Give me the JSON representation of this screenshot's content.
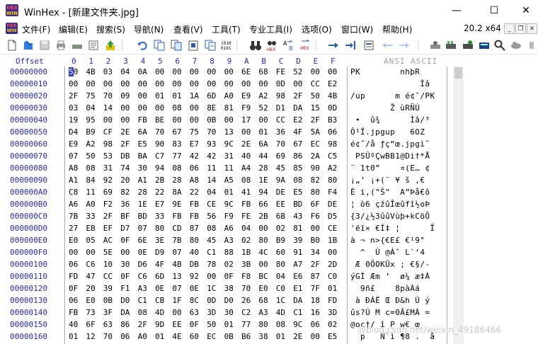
{
  "window": {
    "title": "WinHex - [新建文件夹.jpg]",
    "app_icon": "winhex-icon",
    "minimize": "—",
    "maximize": "☐",
    "close": "✕"
  },
  "menu": {
    "items": [
      "文件(F)",
      "编辑(E)",
      "搜索(S)",
      "导航(N)",
      "查看(V)",
      "工具(T)",
      "专业工具(I)",
      "选项(O)",
      "窗口(W)",
      "帮助(H)"
    ],
    "version": "20.2 x64",
    "mdi_minimize": "_",
    "mdi_restore": "❐",
    "mdi_close": "✕"
  },
  "toolbar": {
    "icons": [
      "new-file-icon",
      "open-file-icon",
      "save-icon",
      "print-icon",
      "disk-icon",
      "properties-icon",
      "up-arrow-icon",
      "undo-icon",
      "copy-icon",
      "paste-block-icon",
      "paste-icon",
      "insert-icon",
      "convert-icon",
      "binoculars-icon",
      "find-hex-icon",
      "replace-text-icon",
      "replace-hex-icon",
      "goto-icon",
      "goto-offset-icon",
      "back-icon",
      "forward-icon",
      "disk-editor-icon",
      "ram-editor-icon",
      "calculator-icon",
      "search-toolbar-icon",
      "cloud-icon"
    ]
  },
  "editor": {
    "offset_header": "Offset",
    "column_headers": [
      "0",
      "1",
      "2",
      "3",
      "4",
      "5",
      "6",
      "7",
      "8",
      "9",
      "A",
      "B",
      "C",
      "D",
      "E",
      "F"
    ],
    "ansi_header": "ANSI ASCII",
    "rows": [
      {
        "offset": "00000000",
        "bytes": [
          "50",
          "4B",
          "03",
          "04",
          "0A",
          "00",
          "00",
          "00",
          "00",
          "00",
          "6E",
          "68",
          "FE",
          "52",
          "00",
          "00"
        ],
        "ansi": "PK        nhþR  "
      },
      {
        "offset": "00000010",
        "bytes": [
          "00",
          "00",
          "00",
          "00",
          "00",
          "00",
          "00",
          "00",
          "00",
          "00",
          "00",
          "00",
          "0D",
          "00",
          "CC",
          "E2"
        ],
        "ansi": "              Ìâ"
      },
      {
        "offset": "00000020",
        "bytes": [
          "2F",
          "75",
          "70",
          "09",
          "00",
          "01",
          "01",
          "1A",
          "6D",
          "A0",
          "E9",
          "A2",
          "98",
          "2F",
          "50",
          "4B"
        ],
        "ansi": "/up      m é¢˜/PK"
      },
      {
        "offset": "00000030",
        "bytes": [
          "03",
          "04",
          "14",
          "00",
          "00",
          "00",
          "08",
          "00",
          "8E",
          "81",
          "F9",
          "52",
          "D1",
          "DA",
          "15",
          "0D"
        ],
        "ansi": "        Ž ùRÑÚ  "
      },
      {
        "offset": "00000040",
        "bytes": [
          "19",
          "95",
          "00",
          "00",
          "FB",
          "BE",
          "00",
          "00",
          "0B",
          "00",
          "17",
          "00",
          "CC",
          "E2",
          "2F",
          "B3"
        ],
        "ansi": " •  û¾      Ìâ/³"
      },
      {
        "offset": "00000050",
        "bytes": [
          "D4",
          "B9",
          "CF",
          "2E",
          "6A",
          "70",
          "67",
          "75",
          "70",
          "13",
          "00",
          "01",
          "36",
          "4F",
          "5A",
          "06"
        ],
        "ansi": "Ô¹Ï.jpgup   6OZ "
      },
      {
        "offset": "00000060",
        "bytes": [
          "E9",
          "A2",
          "98",
          "2F",
          "E5",
          "90",
          "83",
          "E7",
          "93",
          "9C",
          "2E",
          "6A",
          "70",
          "67",
          "EC",
          "98"
        ],
        "ansi": "é¢˜/å ƒç“œ.jpgì˜"
      },
      {
        "offset": "00000070",
        "bytes": [
          "07",
          "50",
          "53",
          "DB",
          "BA",
          "C7",
          "77",
          "42",
          "42",
          "31",
          "40",
          "44",
          "69",
          "86",
          "2A",
          "C5"
        ],
        "ansi": " PSÛºÇwBB1@Di†*Å"
      },
      {
        "offset": "00000080",
        "bytes": [
          "A8",
          "08",
          "31",
          "74",
          "30",
          "94",
          "08",
          "06",
          "11",
          "11",
          "A4",
          "28",
          "45",
          "85",
          "90",
          "A2"
        ],
        "ansi": "¨ 1t0”    ¤(E… ¢"
      },
      {
        "offset": "00000090",
        "bytes": [
          "A1",
          "84",
          "92",
          "20",
          "A1",
          "2B",
          "28",
          "A8",
          "14",
          "A5",
          "08",
          "1E",
          "9A",
          "08",
          "82",
          "80"
        ],
        "ansi": "¡„’ ¡+(¨ ¥ š ‚€"
      },
      {
        "offset": "000000A0",
        "bytes": [
          "C8",
          "11",
          "69",
          "82",
          "28",
          "22",
          "8A",
          "22",
          "04",
          "01",
          "41",
          "94",
          "DE",
          "E5",
          "80",
          "F4"
        ],
        "ansi": "È i‚(\"Š\"  A”Þå€ô"
      },
      {
        "offset": "000000B0",
        "bytes": [
          "A6",
          "A0",
          "F2",
          "36",
          "1E",
          "E7",
          "9E",
          "FB",
          "CE",
          "9C",
          "FB",
          "66",
          "EE",
          "BD",
          "6F",
          "DE"
        ],
        "ansi": "¦ ò6 çžûÎœûfî½oÞ"
      },
      {
        "offset": "000000C0",
        "bytes": [
          "7B",
          "33",
          "2F",
          "BF",
          "BD",
          "33",
          "FB",
          "FB",
          "56",
          "F9",
          "FE",
          "2B",
          "6B",
          "43",
          "F6",
          "D5"
        ],
        "ansi": "{3/¿½3ûûVùþ+kCöÕ"
      },
      {
        "offset": "000000D0",
        "bytes": [
          "27",
          "EB",
          "EF",
          "D7",
          "07",
          "80",
          "CD",
          "87",
          "08",
          "A6",
          "04",
          "00",
          "02",
          "81",
          "00",
          "CE"
        ],
        "ansi": "'ëï× €Í‡ ¦      Î"
      },
      {
        "offset": "000000E0",
        "bytes": [
          "E0",
          "05",
          "AC",
          "0F",
          "6E",
          "3E",
          "7B",
          "80",
          "45",
          "A3",
          "02",
          "80",
          "B9",
          "39",
          "B0",
          "1B"
        ],
        "ansi": "à ¬ n>{€E£ €¹9° "
      },
      {
        "offset": "000000F0",
        "bytes": [
          "00",
          "00",
          "5E",
          "00",
          "0E",
          "D9",
          "07",
          "40",
          "C1",
          "88",
          "1B",
          "4C",
          "60",
          "91",
          "34",
          "00"
        ],
        "ansi": "  ^  Ù @Áˆ L`‘4 "
      },
      {
        "offset": "00000100",
        "bytes": [
          "06",
          "C6",
          "10",
          "30",
          "D6",
          "4F",
          "4B",
          "DB",
          "78",
          "02",
          "3B",
          "00",
          "80",
          "A7",
          "2F",
          "2D"
        ],
        "ansi": " Æ 0ÖOKÛx ; €§/-"
      },
      {
        "offset": "00000110",
        "bytes": [
          "FD",
          "47",
          "CC",
          "0F",
          "C6",
          "6D",
          "13",
          "92",
          "00",
          "0F",
          "F8",
          "BC",
          "04",
          "E6",
          "87",
          "C0"
        ],
        "ansi": "ýGÌ Æm ’  ø¼ æ‡À"
      },
      {
        "offset": "00000120",
        "bytes": [
          "0F",
          "20",
          "39",
          "F1",
          "A3",
          "0E",
          "07",
          "0E",
          "1C",
          "38",
          "70",
          "E0",
          "C0",
          "E1",
          "7F",
          "01"
        ],
        "ansi": "  9ñ£    8pàÀá  "
      },
      {
        "offset": "00000130",
        "bytes": [
          "06",
          "E0",
          "0B",
          "D0",
          "C1",
          "CB",
          "1F",
          "8C",
          "0D",
          "D0",
          "26",
          "68",
          "1C",
          "DA",
          "18",
          "FD"
        ],
        "ansi": " à ÐÁË Œ Ð&h Ú ý"
      },
      {
        "offset": "00000140",
        "bytes": [
          "FB",
          "73",
          "3F",
          "DA",
          "08",
          "4D",
          "00",
          "63",
          "3D",
          "30",
          "C2",
          "A3",
          "4D",
          "C1",
          "16",
          "3D"
        ],
        "ansi": "ûs?Ú M c=0Â£MÁ ="
      },
      {
        "offset": "00000150",
        "bytes": [
          "40",
          "6F",
          "63",
          "86",
          "2F",
          "9D",
          "EE",
          "0F",
          "50",
          "01",
          "77",
          "80",
          "08",
          "9C",
          "06",
          "02"
        ],
        "ansi": "@oc†/ î P w€ œ  "
      },
      {
        "offset": "00000160",
        "bytes": [
          "01",
          "12",
          "70",
          "06",
          "A0",
          "01",
          "4E",
          "60",
          "EC",
          "0B",
          "B6",
          "38",
          "01",
          "2E",
          "00",
          "E5"
        ],
        "ansi": "  p   N`ì ¶8 .  å"
      }
    ]
  },
  "watermark": "@blog.csdn.net/weixin_49186466"
}
